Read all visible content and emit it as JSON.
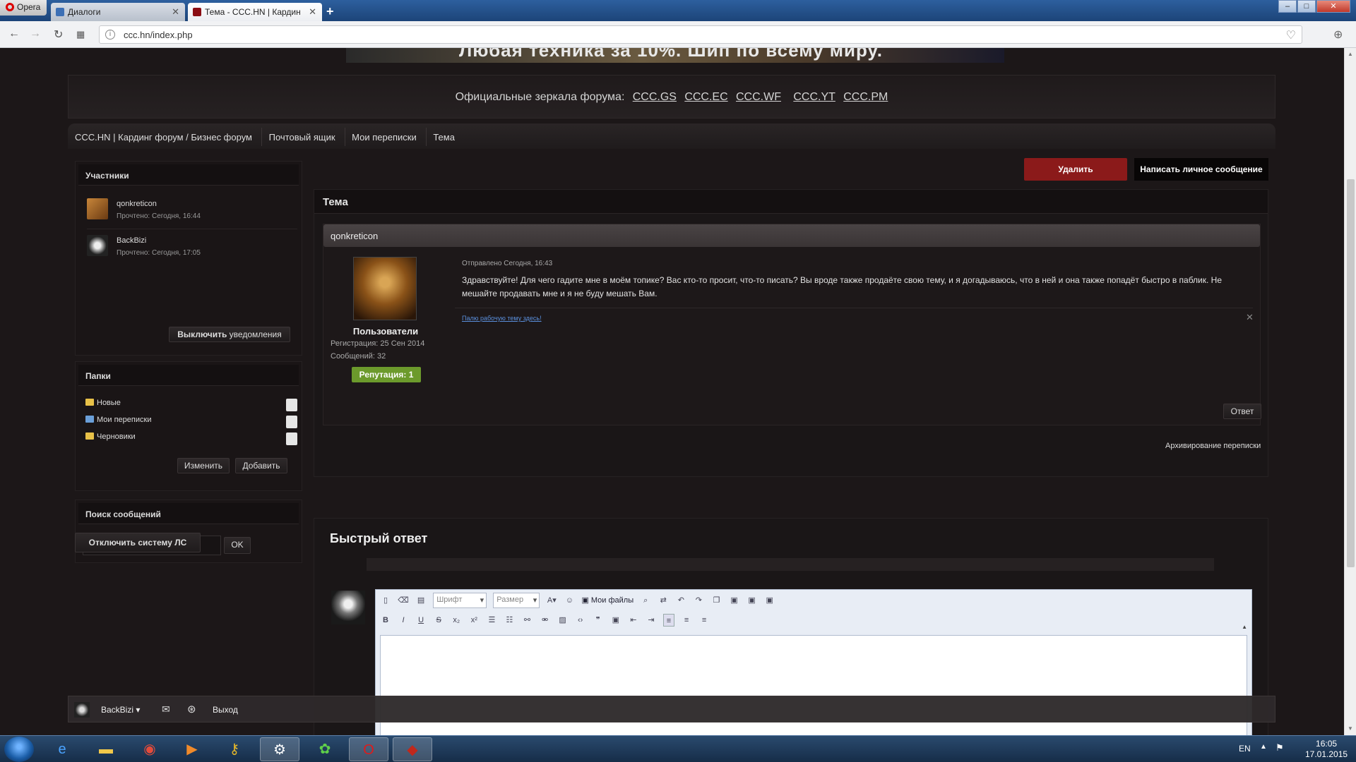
{
  "browser": {
    "opera_label": "Opera",
    "tabs": [
      {
        "label": "Диалоги",
        "close": "✕"
      },
      {
        "label": "Тема - CCC.HN | Кардин",
        "close": "✕"
      }
    ],
    "new_tab": "+",
    "window_controls": {
      "min": "–",
      "max": "□",
      "close": "✕"
    },
    "url": "ccc.hn/index.php",
    "icons": {
      "back": "arrow-left-icon",
      "forward": "arrow-right-icon",
      "reload": "reload-icon",
      "speed_dial": "grid-icon",
      "heart": "heart-icon",
      "download": "download-icon"
    }
  },
  "page": {
    "banner_text": "Любая техника за 10%. Шип по всему миру.",
    "mirrors": {
      "label": "Официальные зеркала форума:",
      "links": [
        "CCC.GS",
        "CCC.EC",
        "CCC.WF",
        "CCC.YT",
        "CCC.PM"
      ]
    },
    "breadcrumb": [
      "CCC.HN | Кардинг форум / Бизнес форум",
      "Почтовый ящик",
      "Мои переписки",
      "Тема"
    ],
    "sidebar": {
      "participants": {
        "title": "Участники",
        "members": [
          {
            "name": "qonkreticon",
            "read": "Прочтено: Сегодня, 16:44"
          },
          {
            "name": "BackBizi",
            "read": "Прочтено: Сегодня, 17:05"
          }
        ],
        "notify_button_bold": "Выключить",
        "notify_button_rest": " уведомления"
      },
      "folders": {
        "title": "Папки",
        "items": [
          "Новые",
          "Мои переписки",
          "Черновики"
        ],
        "edit_button": "Изменить",
        "add_button": "Добавить"
      },
      "search": {
        "title": "Поиск сообщений",
        "input_value": "",
        "ok_button": "OK"
      },
      "disable_pm_button": "Отключить систему ЛС"
    },
    "actions": {
      "delete": "Удалить",
      "write": "Написать личное сообщение"
    },
    "topic": {
      "title": "Тема",
      "message": {
        "author": "qonkreticon",
        "group": "Пользователи",
        "registered": "Регистрация: 25 Сен 2014",
        "posts": "Сообщений: 32",
        "reputation": "Репутация: 1",
        "sent": "Отправлено Сегодня, 16:43",
        "text": "Здравствуйте! Для чего гадите мне в моём топике? Вас кто-то просит, что-то писать? Вы вроде также продаёте свою тему, и я догадываюсь, что в ней и она также попадёт быстро в паблик. Не мешайте продавать мне и я не буду мешать Вам.",
        "signature": "Палю рабочую тему здесь!",
        "reply_button": "Ответ",
        "close_icon": "✕"
      },
      "archive_link": "Архивирование переписки"
    },
    "quick_reply": {
      "title": "Быстрый ответ",
      "font_select": "Шрифт",
      "size_select": "Размер",
      "my_files": "Мои файлы",
      "editor_text": ""
    },
    "forum_bar": {
      "user": "BackBizi",
      "exit": "Выход"
    }
  },
  "taskbar": {
    "lang": "EN",
    "time": "16:05",
    "date": "17.01.2015",
    "apps": [
      "ie-icon",
      "explorer-icon",
      "chrome-icon",
      "media-player-icon",
      "keys-icon",
      "steam-icon",
      "icq-icon",
      "opera-icon",
      "dota-icon"
    ]
  },
  "colors": {
    "delete": "#8b1a1a",
    "reputation": "#6c9a2c",
    "accent_link": "#5a8fdc"
  }
}
